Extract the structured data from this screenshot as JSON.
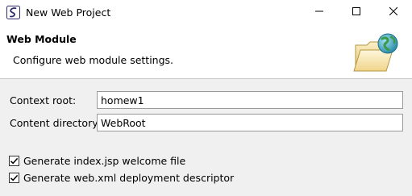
{
  "window": {
    "title": "New Web Project",
    "app_icon": "eclipse-logo-icon",
    "controls": [
      "minimize-icon",
      "maximize-icon",
      "close-icon"
    ]
  },
  "banner": {
    "title": "Web Module",
    "description": "Configure web module settings.",
    "icon": "folder-globe-icon"
  },
  "form": {
    "context_root": {
      "label": "Context root:",
      "value": "homew1"
    },
    "content_directory": {
      "label": "Content directory:",
      "value": "WebRoot"
    }
  },
  "options": [
    {
      "label": "Generate index.jsp welcome file",
      "checked": true
    },
    {
      "label": "Generate web.xml deployment descriptor",
      "checked": true
    }
  ],
  "colors": {
    "window_bg": "#f0f0f0",
    "banner_bg": "#ffffff",
    "input_border": "#9a9a9a"
  }
}
